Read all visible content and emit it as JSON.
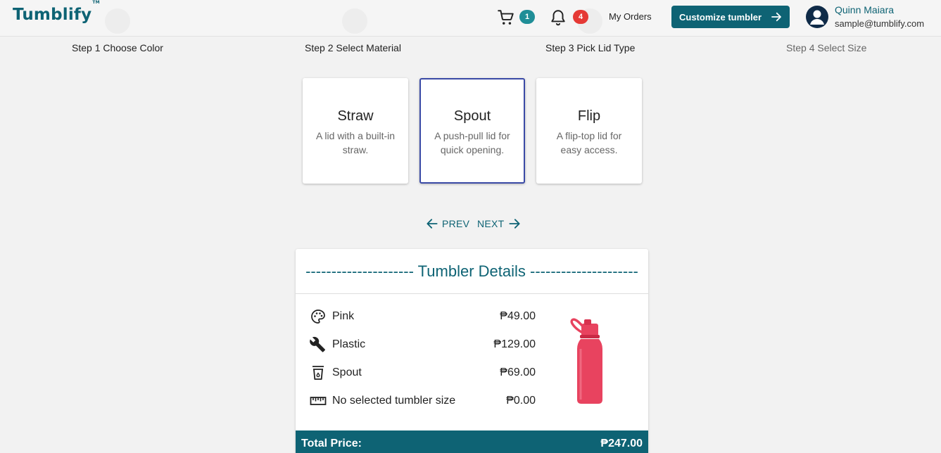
{
  "header": {
    "logo": "Tumblify",
    "logo_tm": "TM",
    "cart_count": "1",
    "notification_count": "4",
    "my_orders": "My Orders",
    "customize_label": "Customize tumbler",
    "user_name": "Quinn Maiara",
    "user_email": "sample@tumblify.com"
  },
  "steps": [
    {
      "label": "Step 1 Choose Color"
    },
    {
      "label": "Step 2 Select Material"
    },
    {
      "label": "Step 3 Pick Lid Type"
    },
    {
      "label": "Step 4 Select Size"
    }
  ],
  "lids": [
    {
      "title": "Straw",
      "desc": "A lid with a built-in straw."
    },
    {
      "title": "Spout",
      "desc": "A push-pull lid for quick opening."
    },
    {
      "title": "Flip",
      "desc": "A flip-top lid for easy access."
    }
  ],
  "selected_lid": "Spout",
  "nav": {
    "prev": "PREV",
    "next": "NEXT"
  },
  "details": {
    "title": "--------------------- Tumbler Details ---------------------",
    "rows": [
      {
        "icon": "palette-icon",
        "label": "Pink",
        "price": "₱49.00"
      },
      {
        "icon": "wrench-icon",
        "label": "Plastic",
        "price": "₱129.00"
      },
      {
        "icon": "cup-icon",
        "label": "Spout",
        "price": "₱69.00"
      },
      {
        "icon": "ruler-icon",
        "label": "No selected tumbler size",
        "price": "₱0.00"
      }
    ],
    "total_label": "Total Price:",
    "total_value": "₱247.00"
  },
  "colors": {
    "brand": "#0e6374",
    "selected_border": "#3a4aa6",
    "badge_teal": "#1f8e97",
    "badge_red": "#e53935",
    "tumbler": "#e8435f"
  }
}
